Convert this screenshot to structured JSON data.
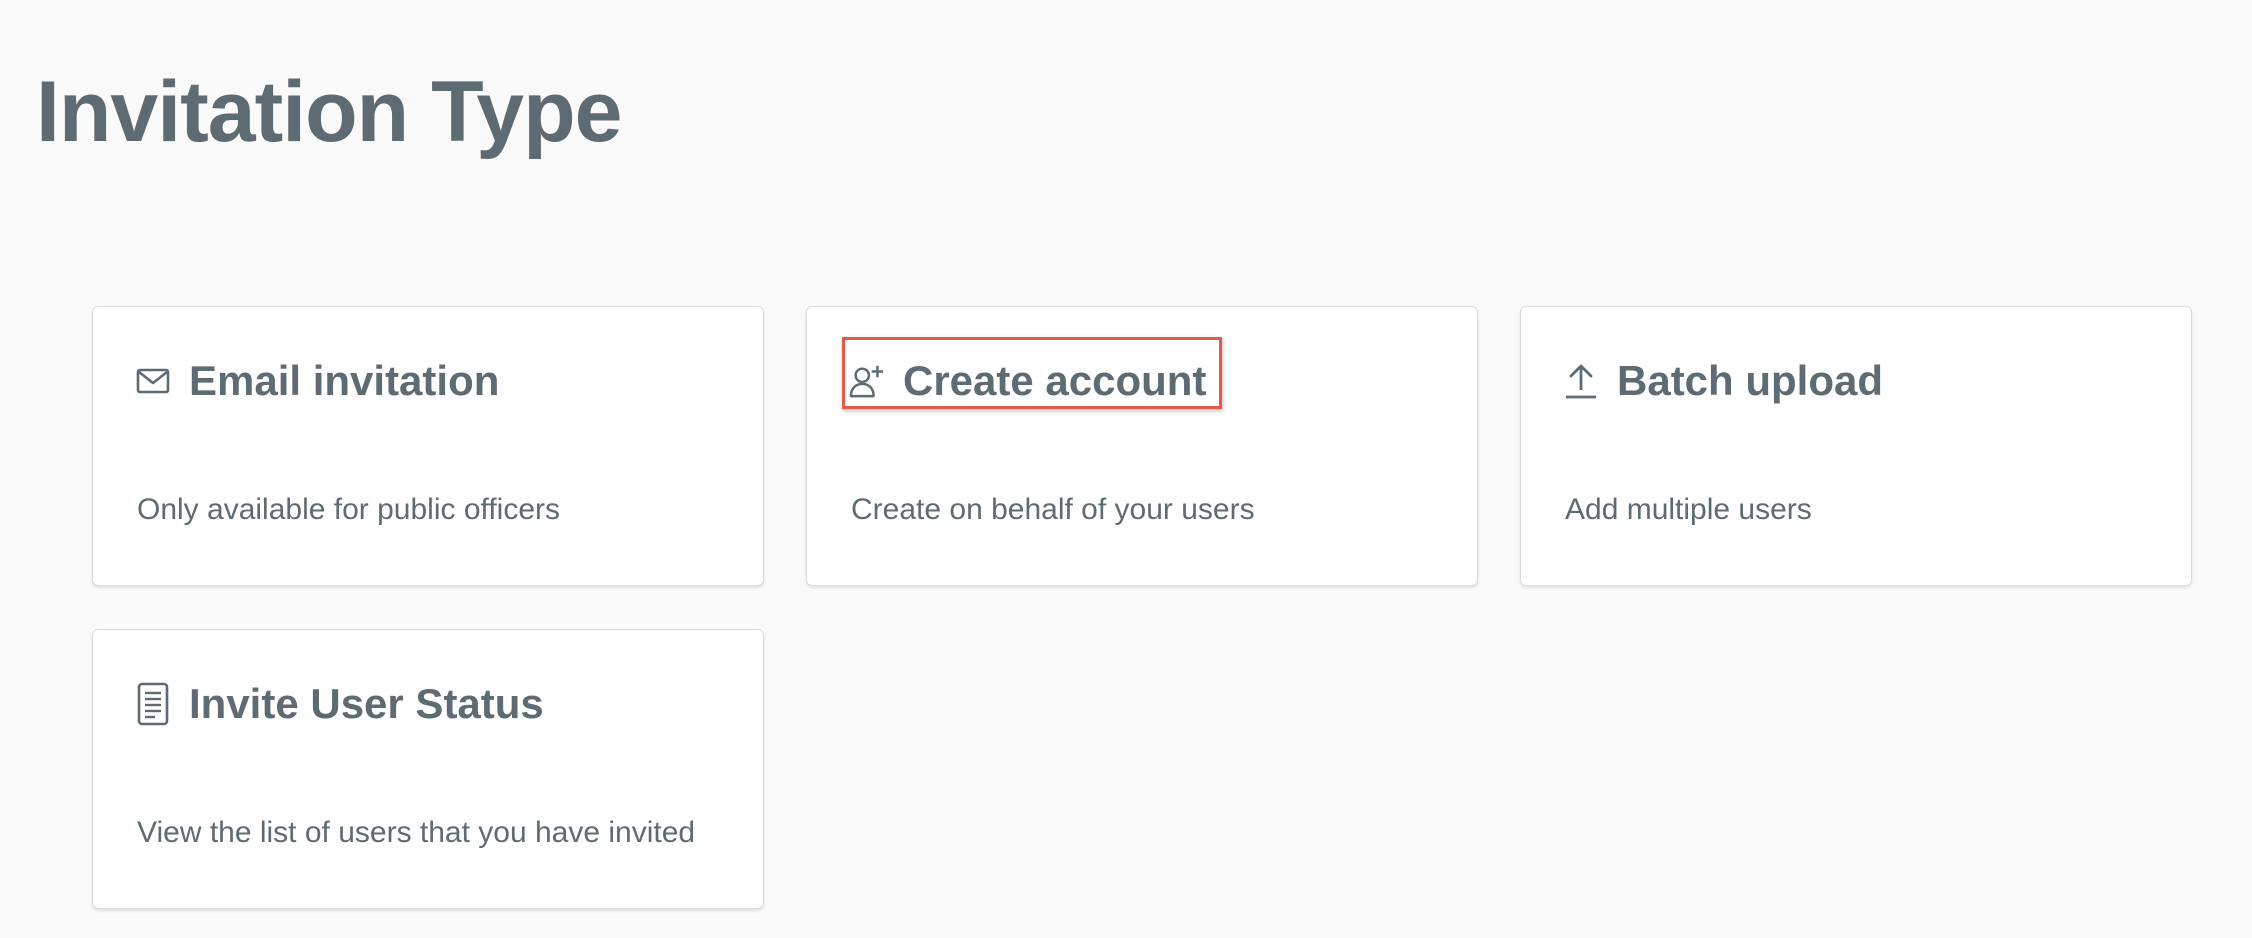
{
  "page": {
    "title": "Invitation Type"
  },
  "cards": [
    {
      "icon": "mail-icon",
      "title": "Email invitation",
      "description": "Only available for public officers"
    },
    {
      "icon": "user-plus-icon",
      "title": "Create account",
      "description": "Create on behalf of your users",
      "highlighted": true
    },
    {
      "icon": "upload-icon",
      "title": "Batch upload",
      "description": "Add multiple users"
    },
    {
      "icon": "document-icon",
      "title": "Invite User Status",
      "description": "View the list of users that you have invited"
    }
  ],
  "colors": {
    "background": "#fafafa",
    "card": "#ffffff",
    "text": "#5f6b73",
    "highlight_border": "#e5594a"
  }
}
